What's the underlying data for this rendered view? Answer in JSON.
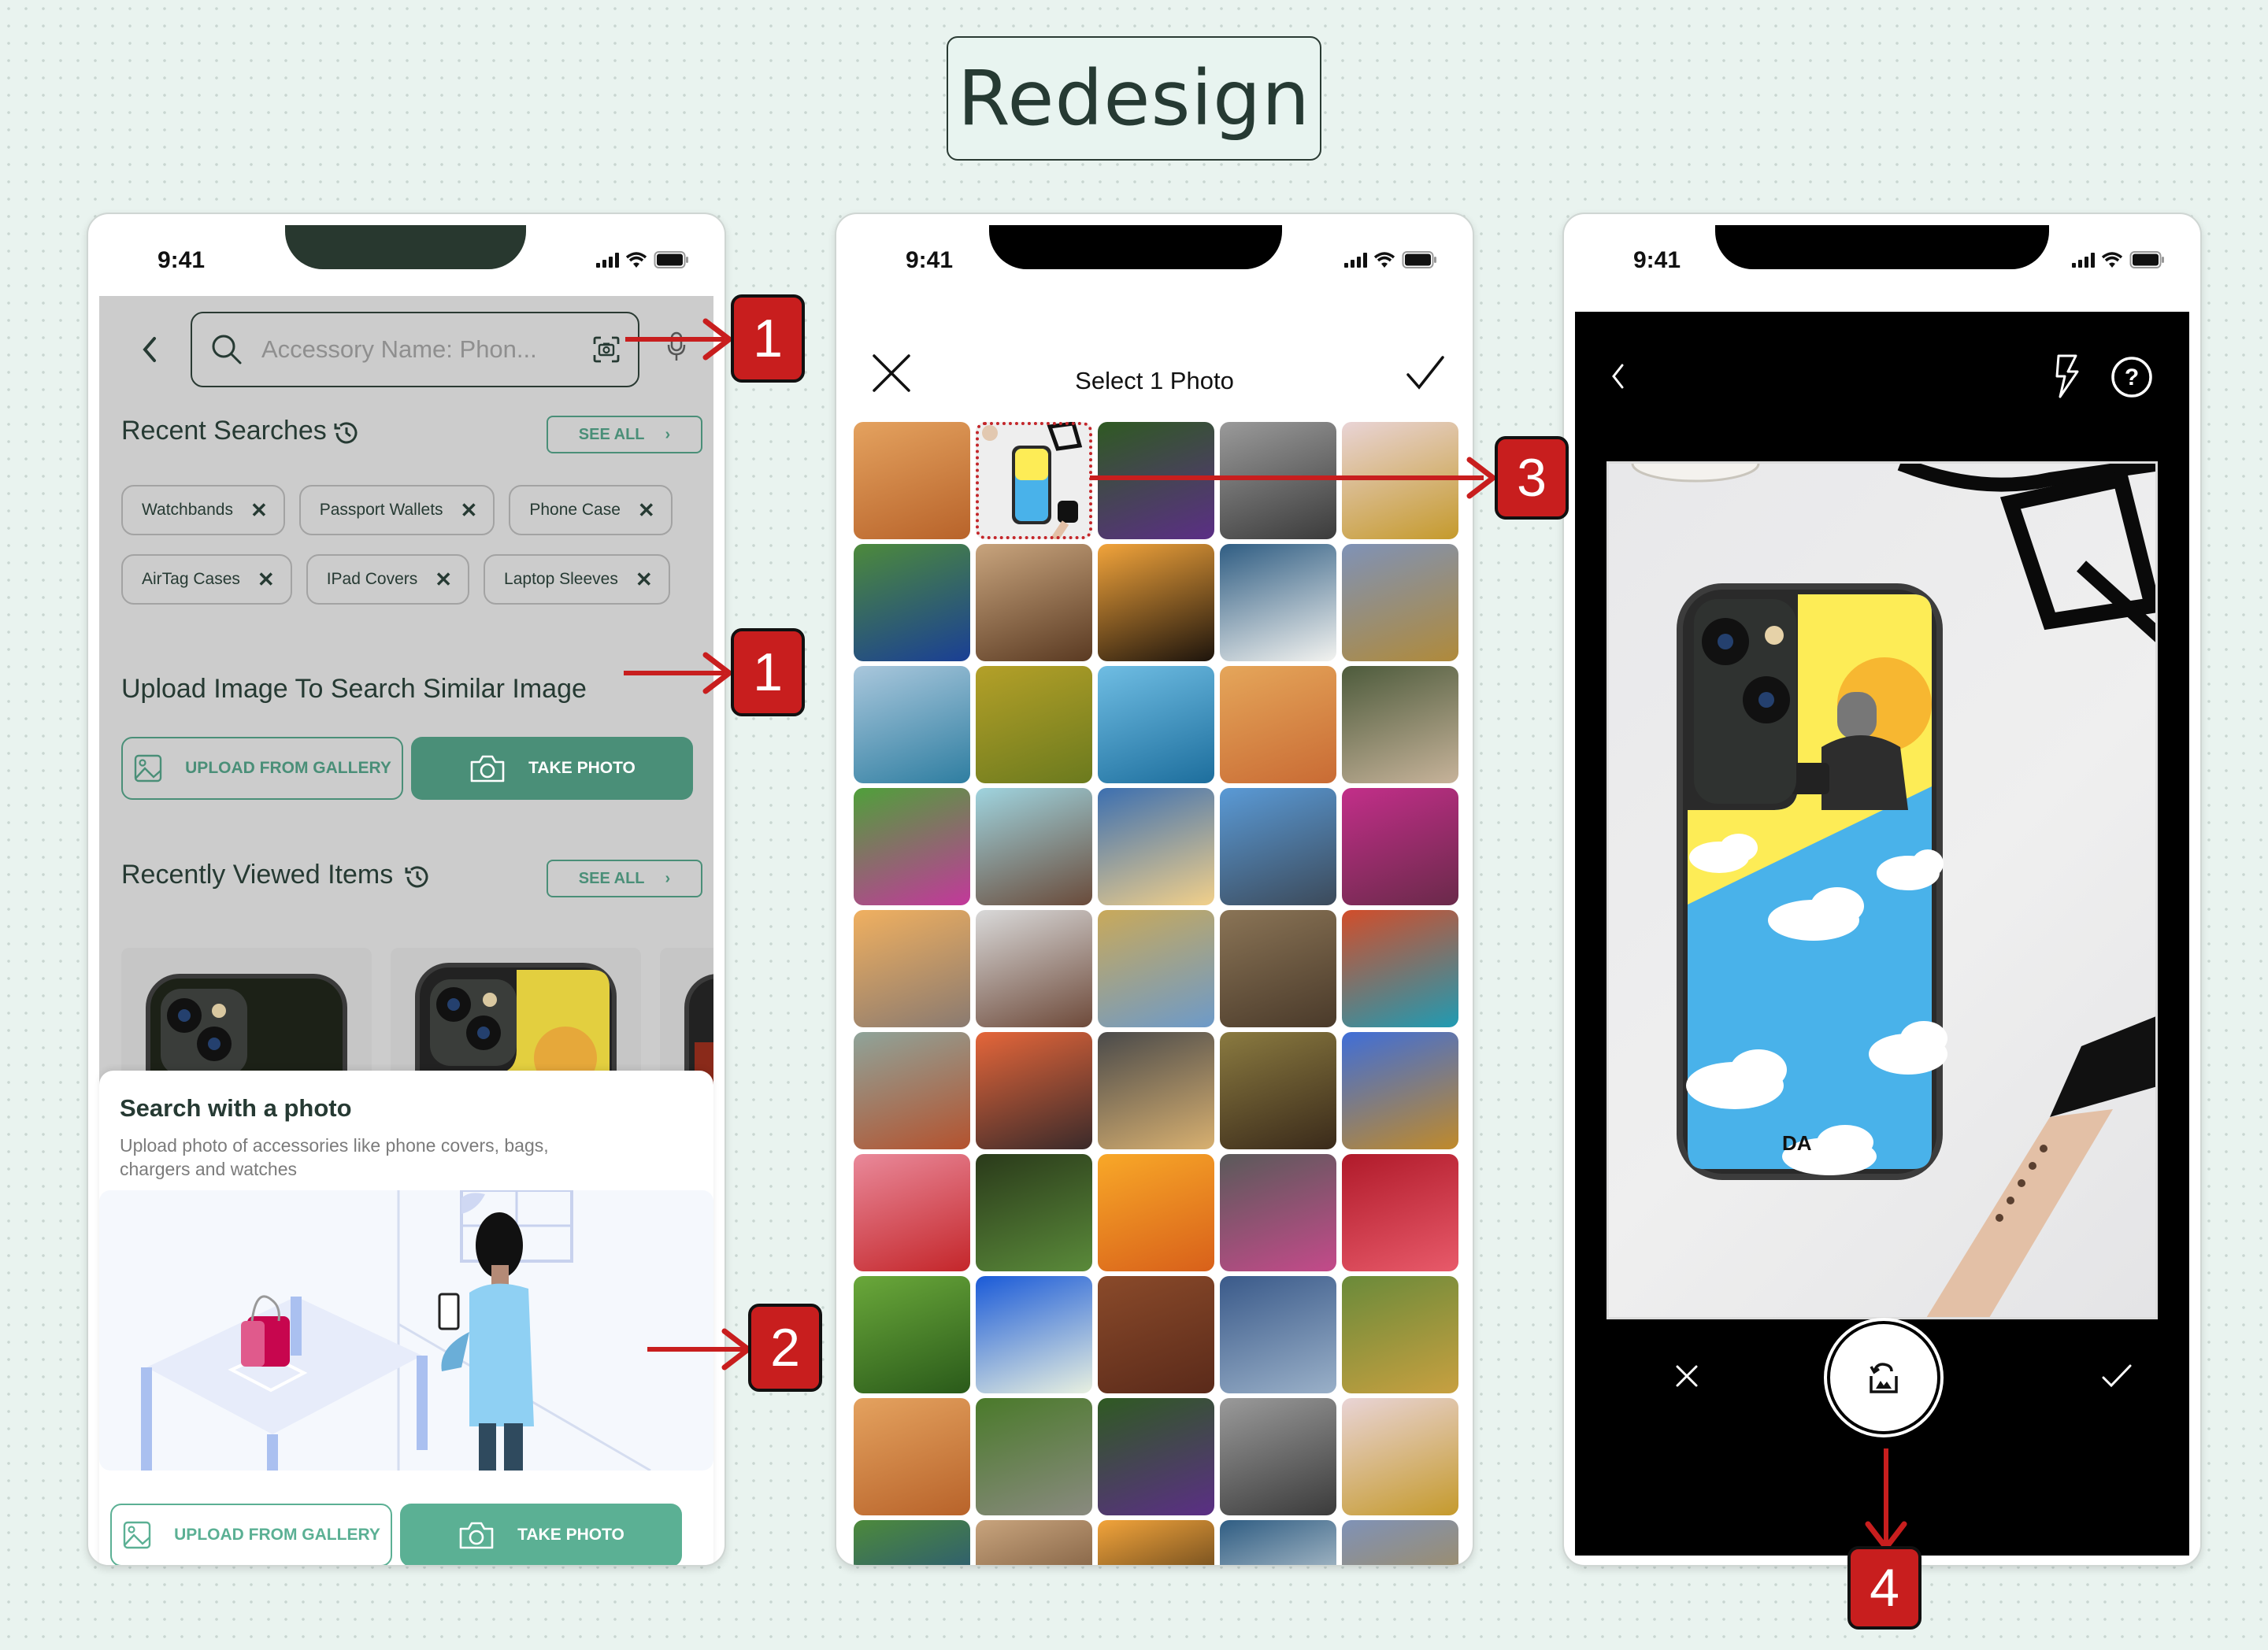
{
  "title": "Redesign",
  "status_bar": {
    "time": "9:41"
  },
  "screen_search": {
    "search_placeholder": "Accessory Name: Phon...",
    "recent_searches": {
      "title": "Recent Searches",
      "see_all": "SEE ALL",
      "chips": [
        "Watchbands",
        "Passport Wallets",
        "Phone Case",
        "AirTag Cases",
        "IPad Covers",
        "Laptop Sleeves"
      ]
    },
    "upload_section": {
      "title": "Upload Image To Search Similar Image",
      "upload_button": "UPLOAD FROM GALLERY",
      "take_photo_button": "TAKE PHOTO"
    },
    "recently_viewed": {
      "title": "Recently Viewed Items",
      "see_all": "SEE ALL"
    },
    "sheet": {
      "title": "Search with a photo",
      "subtitle": "Upload photo of accessories like phone covers, bags, chargers and watches",
      "upload_button": "UPLOAD FROM GALLERY",
      "take_photo_button": "TAKE PHOTO"
    }
  },
  "screen_picker": {
    "title": "Select 1 Photo",
    "selected_index": 1,
    "photos": [
      {
        "name": "desert",
        "c1": "#e4a25f",
        "c2": "#b8632a"
      },
      {
        "name": "phone-case",
        "c1": "#eeeeee",
        "c2": "#cfd9e4"
      },
      {
        "name": "butterfly",
        "c1": "#2f5a22",
        "c2": "#5b2e86"
      },
      {
        "name": "railway",
        "c1": "#9a9a9a",
        "c2": "#3b3b3b"
      },
      {
        "name": "cathedral-dome",
        "c1": "#e9d4d6",
        "c2": "#c59a2c"
      },
      {
        "name": "peacock",
        "c1": "#4d8a3b",
        "c2": "#1a3f95"
      },
      {
        "name": "organ",
        "c1": "#c8a47d",
        "c2": "#5a3a22"
      },
      {
        "name": "candles",
        "c1": "#f2a43b",
        "c2": "#1d140c"
      },
      {
        "name": "white-flower",
        "c1": "#2f5d83",
        "c2": "#f3f3f0"
      },
      {
        "name": "textured-waves",
        "c1": "#7f92b7",
        "c2": "#b08a3a"
      },
      {
        "name": "lighthouse",
        "c1": "#a9c7dc",
        "c2": "#2f7ea1"
      },
      {
        "name": "blue-butterfly",
        "c1": "#b4a028",
        "c2": "#6b7a1e"
      },
      {
        "name": "kayak",
        "c1": "#6fbde3",
        "c2": "#1d6e9d"
      },
      {
        "name": "woman-portrait",
        "c1": "#e5a65a",
        "c2": "#c96b34"
      },
      {
        "name": "woman-hat",
        "c1": "#4d5b3c",
        "c2": "#c7b39a"
      },
      {
        "name": "clover-flowers",
        "c1": "#4fa03a",
        "c2": "#c3389b"
      },
      {
        "name": "beach-woman",
        "c1": "#9fd4df",
        "c2": "#6a4b3a"
      },
      {
        "name": "snow-sunset",
        "c1": "#3c6fb0",
        "c2": "#f2d08a"
      },
      {
        "name": "eiffel-tower",
        "c1": "#5a9ad6",
        "c2": "#3c4a5a"
      },
      {
        "name": "holi-dancer",
        "c1": "#c22e89",
        "c2": "#6a2a4a"
      },
      {
        "name": "beach-couple",
        "c1": "#f0b060",
        "c2": "#8a7a70"
      },
      {
        "name": "city-street",
        "c1": "#d9d9d9",
        "c2": "#6e4a3a"
      },
      {
        "name": "dirt-road",
        "c1": "#c9a95a",
        "c2": "#6d9ac9"
      },
      {
        "name": "abbey-ruins",
        "c1": "#8a7456",
        "c2": "#4a3a2a"
      },
      {
        "name": "mountain-lake",
        "c1": "#d24d2a",
        "c2": "#1f9bb3"
      },
      {
        "name": "curly-hair",
        "c1": "#8fa49a",
        "c2": "#b4522e"
      },
      {
        "name": "sunset-reflection",
        "c1": "#e5663a",
        "c2": "#3a2a2a"
      },
      {
        "name": "lighthouse-storm",
        "c1": "#4a4a4a",
        "c2": "#d8b070"
      },
      {
        "name": "cathedral-arches",
        "c1": "#8a7a40",
        "c2": "#3a2a1a"
      },
      {
        "name": "blue-flower",
        "c1": "#3f6ed8",
        "c2": "#c08a2a"
      },
      {
        "name": "poppies",
        "c1": "#e9899a",
        "c2": "#c4262a"
      },
      {
        "name": "bubbles",
        "c1": "#2a3a1a",
        "c2": "#5a8a3a"
      },
      {
        "name": "orange-sky",
        "c1": "#f8a828",
        "c2": "#d8601a"
      },
      {
        "name": "makeup-palette",
        "c1": "#5a5a5a",
        "c2": "#c44a8a"
      },
      {
        "name": "pomegranate",
        "c1": "#b01a2a",
        "c2": "#e85a6a"
      },
      {
        "name": "green-leaves",
        "c1": "#6aa83a",
        "c2": "#2a5a1a"
      },
      {
        "name": "lemonade",
        "c1": "#1a5ad8",
        "c2": "#e8f0e0"
      },
      {
        "name": "hazelnuts",
        "c1": "#8a4a2a",
        "c2": "#5a2a1a"
      },
      {
        "name": "wolves",
        "c1": "#3a5a8a",
        "c2": "#9ab0c8"
      },
      {
        "name": "family-walk",
        "c1": "#6a8a3a",
        "c2": "#c8a040"
      },
      {
        "name": "desert",
        "c1": "#e4a25f",
        "c2": "#b8632a"
      },
      {
        "name": "geese",
        "c1": "#4a7a2a",
        "c2": "#8a8a80"
      },
      {
        "name": "butterfly",
        "c1": "#2f5a22",
        "c2": "#5b2e86"
      },
      {
        "name": "railway",
        "c1": "#9a9a9a",
        "c2": "#3b3b3b"
      },
      {
        "name": "cathedral-dome",
        "c1": "#e9d4d6",
        "c2": "#c59a2c"
      },
      {
        "name": "peacock",
        "c1": "#4d8a3b",
        "c2": "#1a3f95"
      },
      {
        "name": "organ",
        "c1": "#c8a47d",
        "c2": "#5a3a22"
      },
      {
        "name": "candles",
        "c1": "#f2a43b",
        "c2": "#1d140c"
      },
      {
        "name": "white-flower",
        "c1": "#2f5d83",
        "c2": "#f3f3f0"
      },
      {
        "name": "textured-waves",
        "c1": "#7f92b7",
        "c2": "#b08a3a"
      }
    ]
  },
  "screen_camera": {
    "logo_text": "DA"
  },
  "annotations": [
    "1",
    "1",
    "2",
    "3",
    "4"
  ],
  "colors": {
    "accent": "#4a8f78",
    "accent_light": "#5bb094",
    "annotation_red": "#c81e1e",
    "dark_text": "#263a33"
  }
}
